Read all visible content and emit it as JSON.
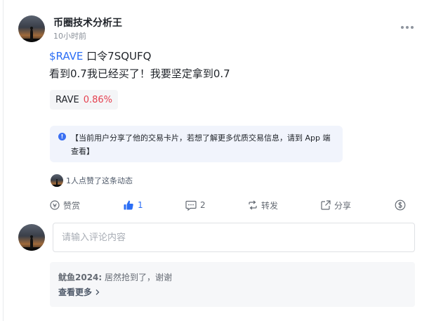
{
  "post": {
    "author_name": "币圈技术分析王",
    "time": "10小时前",
    "ticker_link": "$RAVE",
    "code_text": " 口令7SQUFQ",
    "body_line2": "看到0.7我已经买了！我要坚定拿到0.7"
  },
  "ticker_chip": {
    "symbol": "RAVE",
    "change": "0.86%",
    "change_color": "#e5404f"
  },
  "notice": {
    "text": "【当前用户分享了他的交易卡片，若想了解更多优质交易信息，请到 App 端查看】"
  },
  "likes": {
    "summary": "1人点赞了这条动态"
  },
  "actions": {
    "reward_label": "赞赏",
    "like_count": "1",
    "comment_count": "2",
    "repost_label": "转发",
    "share_label": "分享"
  },
  "comment_input": {
    "placeholder": "请输入评论内容"
  },
  "comments": {
    "author": "鱿鱼2024:",
    "text": " 居然抢到了，谢谢",
    "view_more": "查看更多"
  },
  "icons": {
    "reward": "reward-coin-icon",
    "like": "thumbs-up-icon",
    "comment": "comment-bubble-icon",
    "repost": "repost-arrows-icon",
    "share": "share-arrow-icon",
    "tip": "dollar-circle-icon",
    "more": "more-dots-icon",
    "info": "info-icon"
  },
  "colors": {
    "accent": "#2b6ef5",
    "negative_change": "#e5404f",
    "notice_bg": "#f1f4fc"
  }
}
